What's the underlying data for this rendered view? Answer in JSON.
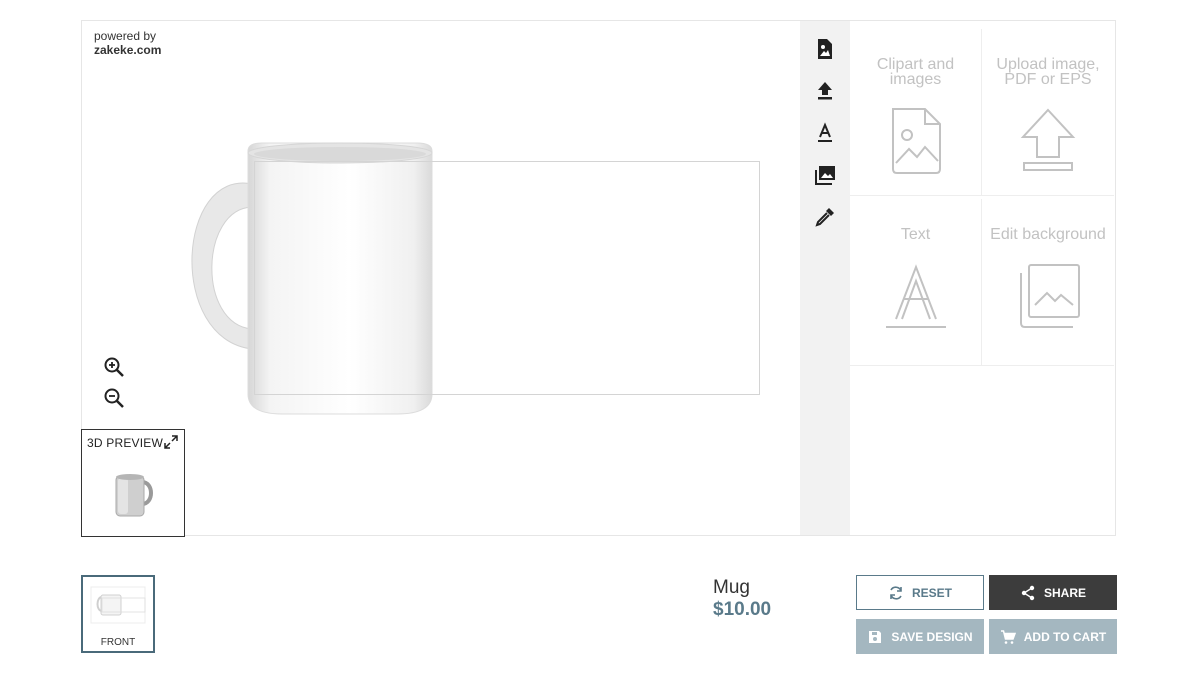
{
  "powered": {
    "line1": "powered by",
    "line2": "zakeke.com"
  },
  "canvas": {
    "zoom_in_icon": "zoom-in-icon",
    "zoom_out_icon": "zoom-out-icon"
  },
  "preview": {
    "label": "3D PREVIEW",
    "expand_icon": "expand-icon"
  },
  "toolbar": {
    "items": [
      {
        "name": "clipart-image-icon"
      },
      {
        "name": "upload-icon"
      },
      {
        "name": "text-icon"
      },
      {
        "name": "background-images-icon"
      },
      {
        "name": "eyedropper-icon"
      }
    ]
  },
  "panel": {
    "tiles": [
      {
        "label": "Clipart and images",
        "icon": "image-file-icon"
      },
      {
        "label": "Upload image, PDF or EPS",
        "icon": "upload-arrow-icon"
      },
      {
        "label": "Text",
        "icon": "letter-a-icon"
      },
      {
        "label": "Edit background",
        "icon": "background-icon"
      }
    ]
  },
  "sides": [
    {
      "label": "FRONT"
    }
  ],
  "product": {
    "name": "Mug",
    "price": "$10.00"
  },
  "actions": {
    "reset": "RESET",
    "share": "SHARE",
    "save": "SAVE DESIGN",
    "cart": "ADD TO CART"
  },
  "colors": {
    "accent": "#5a7a8a",
    "dark_button": "#3c3c3c",
    "disabled_button": "#a4b7c0",
    "toolbar_bg": "#f2f2f2",
    "tile_text": "#c2c2c2"
  }
}
